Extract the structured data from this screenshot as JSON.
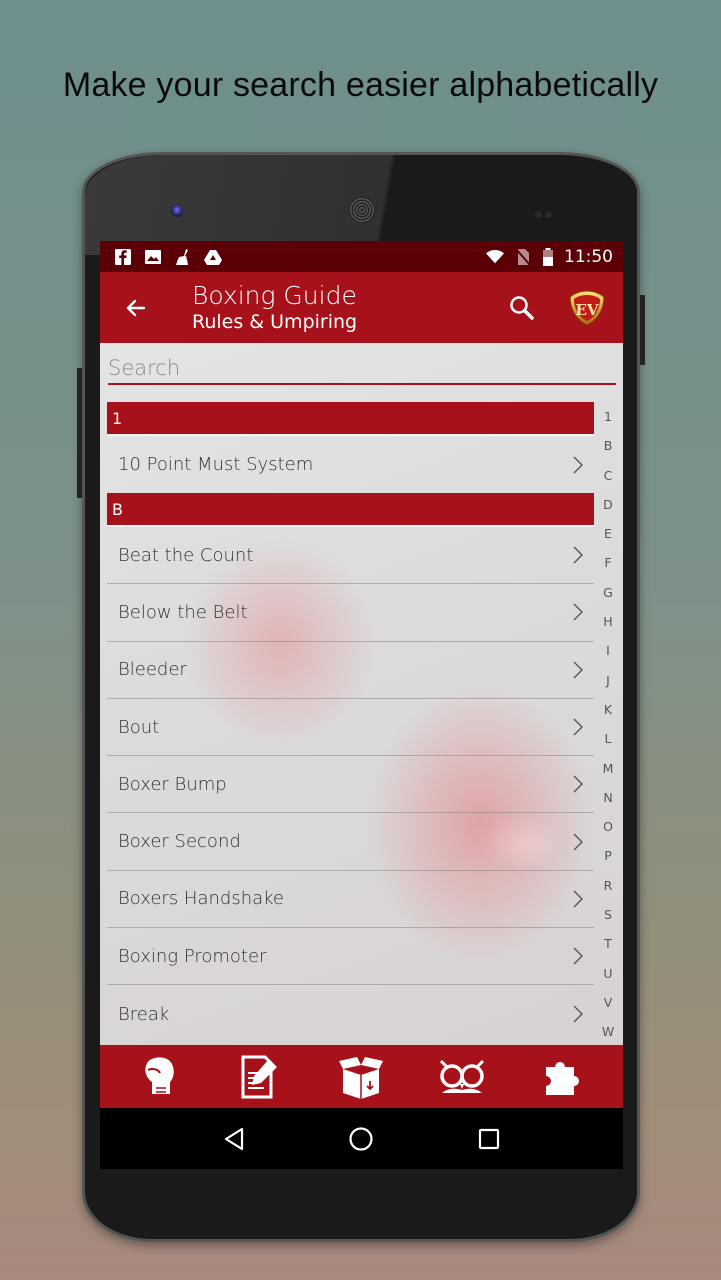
{
  "caption": "Make your search easier alphabetically",
  "status_bar": {
    "notification_icons": [
      "facebook-icon",
      "image-icon",
      "cleaner-icon",
      "drive-icon"
    ],
    "system_icons": [
      "wifi-icon",
      "no-sim-icon",
      "battery-icon"
    ],
    "time": "11:50"
  },
  "app_bar": {
    "title": "Boxing Guide",
    "subtitle": "Rules & Umpiring",
    "back_icon": "arrow-left-icon",
    "search_icon": "search-icon",
    "logo_text": "EV"
  },
  "search": {
    "placeholder": "Search",
    "value": ""
  },
  "sections": [
    {
      "header": "1",
      "items": [
        "10 Point Must System"
      ]
    },
    {
      "header": "B",
      "items": [
        "Beat the Count",
        "Below the Belt",
        "Bleeder",
        "Bout",
        "Boxer Bump",
        "Boxer Second",
        "Boxers Handshake",
        "Boxing Promoter",
        "Break"
      ]
    }
  ],
  "alpha_index": [
    "1",
    "B",
    "C",
    "D",
    "E",
    "F",
    "G",
    "H",
    "I",
    "J",
    "K",
    "L",
    "M",
    "N",
    "O",
    "P",
    "R",
    "S",
    "T",
    "U",
    "V",
    "W"
  ],
  "bottom_tabs": [
    {
      "name": "boxing-glove-icon"
    },
    {
      "name": "edit-document-icon"
    },
    {
      "name": "open-box-icon"
    },
    {
      "name": "owl-icon"
    },
    {
      "name": "puzzle-icon"
    }
  ],
  "nav_bar": [
    "back-triangle-icon",
    "home-circle-icon",
    "recents-square-icon"
  ],
  "colors": {
    "primary": "#a6111a",
    "status_bar": "#5a0006",
    "text": "#333333"
  }
}
